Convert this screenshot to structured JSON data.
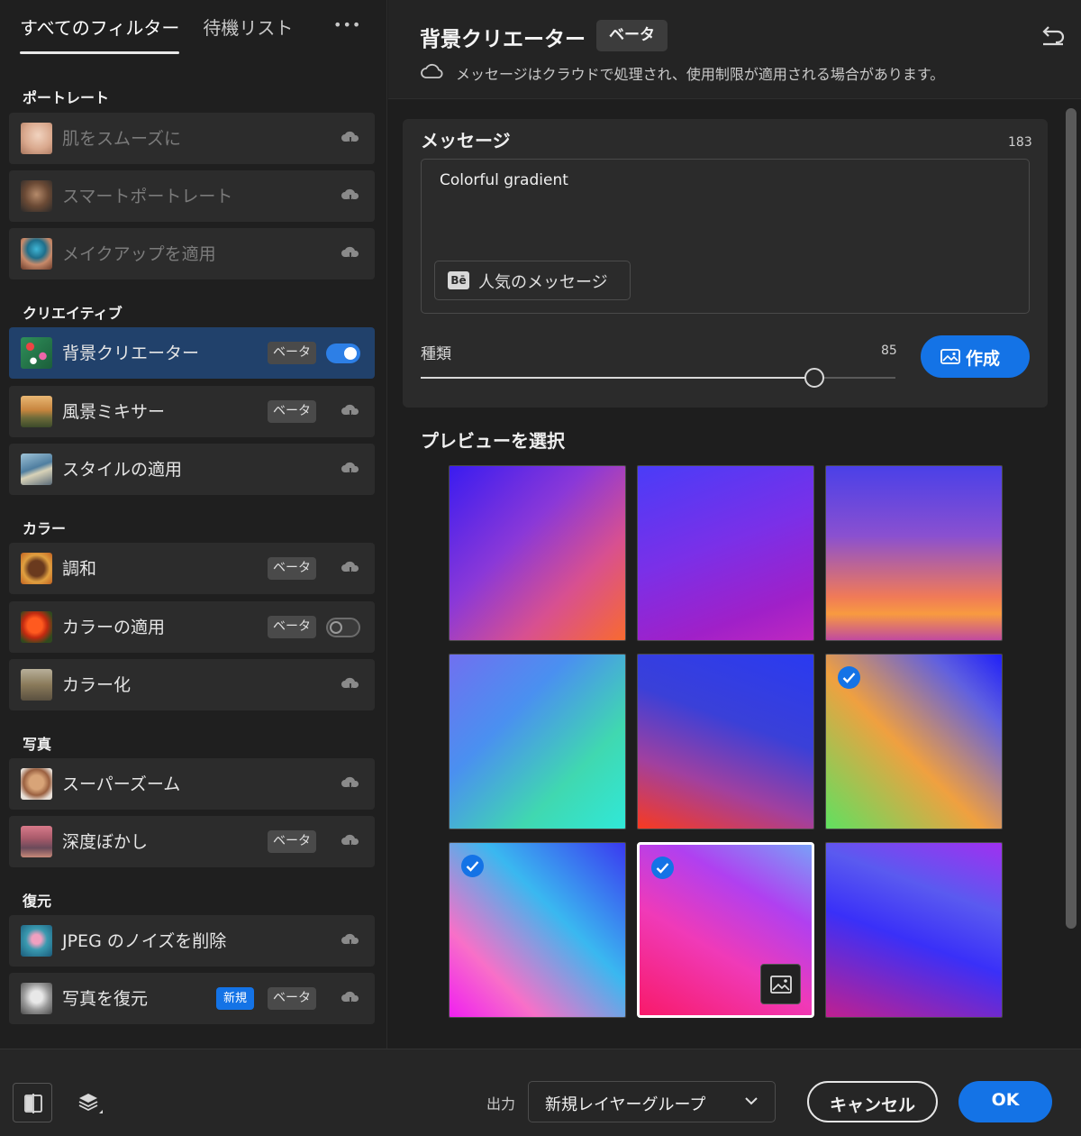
{
  "tabs": {
    "all_filters": "すべてのフィルター",
    "waitlist": "待機リスト",
    "more": "•••"
  },
  "sections": {
    "portrait": "ポートレート",
    "creative": "クリエイティブ",
    "color": "カラー",
    "photo": "写真",
    "restore": "復元"
  },
  "filters": [
    {
      "label": "肌をスムーズに",
      "enabled": false,
      "badge": "",
      "new_badge": "",
      "icon": "cloud-download-icon"
    },
    {
      "label": "スマートポートレート",
      "enabled": false,
      "badge": "",
      "new_badge": "",
      "icon": "cloud-download-icon"
    },
    {
      "label": "メイクアップを適用",
      "enabled": false,
      "badge": "",
      "new_badge": "",
      "icon": "cloud-download-icon"
    },
    {
      "label": "背景クリエーター",
      "enabled": true,
      "badge": "ベータ",
      "new_badge": "",
      "icon": "toggle-on"
    },
    {
      "label": "風景ミキサー",
      "enabled": true,
      "badge": "ベータ",
      "new_badge": "",
      "icon": "cloud-download-icon"
    },
    {
      "label": "スタイルの適用",
      "enabled": true,
      "badge": "",
      "new_badge": "",
      "icon": "cloud-download-icon"
    },
    {
      "label": "調和",
      "enabled": true,
      "badge": "ベータ",
      "new_badge": "",
      "icon": "cloud-download-icon"
    },
    {
      "label": "カラーの適用",
      "enabled": true,
      "badge": "ベータ",
      "new_badge": "",
      "icon": "toggle-off"
    },
    {
      "label": "カラー化",
      "enabled": true,
      "badge": "",
      "new_badge": "",
      "icon": "cloud-download-icon"
    },
    {
      "label": "スーパーズーム",
      "enabled": true,
      "badge": "",
      "new_badge": "",
      "icon": "cloud-download-icon"
    },
    {
      "label": "深度ぼかし",
      "enabled": true,
      "badge": "ベータ",
      "new_badge": "",
      "icon": "cloud-download-icon"
    },
    {
      "label": "JPEG のノイズを削除",
      "enabled": true,
      "badge": "",
      "new_badge": "",
      "icon": "cloud-download-icon"
    },
    {
      "label": "写真を復元",
      "enabled": true,
      "badge": "ベータ",
      "new_badge": "新規",
      "icon": "cloud-download-icon"
    }
  ],
  "header": {
    "title": "背景クリエーター",
    "badge": "ベータ",
    "info": "メッセージはクラウドで処理され、使用制限が適用される場合があります。"
  },
  "prompt": {
    "title": "メッセージ",
    "char_count": "183",
    "value": "Colorful gradient",
    "popular_logo": "Bē",
    "popular_label": "人気のメッセージ"
  },
  "variety": {
    "label": "種類",
    "value": "85",
    "fraction": 0.83
  },
  "generate_label": "作成",
  "preview": {
    "title": "プレビューを選択",
    "selected": [
      5,
      6,
      7
    ],
    "active": 7
  },
  "footer": {
    "output_label": "出力",
    "output_value": "新規レイヤーグループ",
    "cancel": "キャンセル",
    "ok": "OK"
  },
  "colors": {
    "accent": "#1473e6",
    "selected_row": "#21416b"
  }
}
